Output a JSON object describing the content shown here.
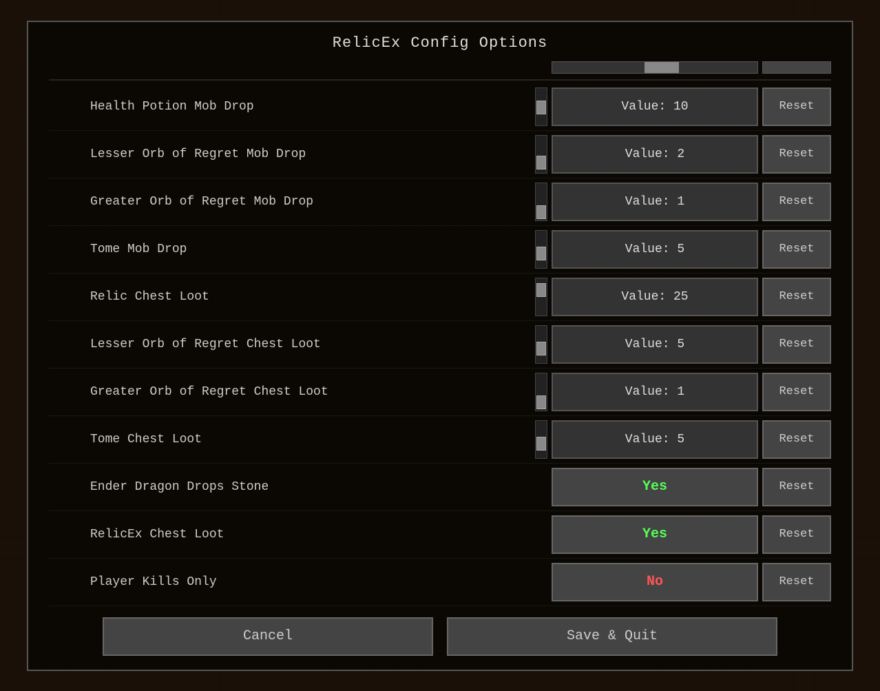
{
  "title": "RelicEx Config Options",
  "rows": [
    {
      "id": "health-potion-mob-drop",
      "label": "Health Potion Mob Drop",
      "type": "slider",
      "value": "Value: 10",
      "sliderPos": 0.5
    },
    {
      "id": "lesser-orb-mob-drop",
      "label": "Lesser Orb of Regret Mob Drop",
      "type": "slider",
      "value": "Value: 2",
      "sliderPos": 0.2
    },
    {
      "id": "greater-orb-mob-drop",
      "label": "Greater Orb of Regret Mob Drop",
      "type": "slider",
      "value": "Value: 1",
      "sliderPos": 0.1
    },
    {
      "id": "tome-mob-drop",
      "label": "Tome Mob Drop",
      "type": "slider",
      "value": "Value: 5",
      "sliderPos": 0.35
    },
    {
      "id": "relic-chest-loot",
      "label": "Relic Chest Loot",
      "type": "slider",
      "value": "Value: 25",
      "sliderPos": 0.8
    },
    {
      "id": "lesser-orb-chest-loot",
      "label": "Lesser Orb of Regret Chest Loot",
      "type": "slider",
      "value": "Value: 5",
      "sliderPos": 0.35
    },
    {
      "id": "greater-orb-chest-loot",
      "label": "Greater Orb of Regret Chest Loot",
      "type": "slider",
      "value": "Value: 1",
      "sliderPos": 0.1
    },
    {
      "id": "tome-chest-loot",
      "label": "Tome Chest Loot",
      "type": "slider",
      "value": "Value: 5",
      "sliderPos": 0.35
    },
    {
      "id": "ender-dragon-drops-stone",
      "label": "Ender Dragon Drops Stone",
      "type": "toggle",
      "value": "Yes",
      "toggleState": "yes"
    },
    {
      "id": "relicex-chest-loot",
      "label": "RelicEx Chest Loot",
      "type": "toggle",
      "value": "Yes",
      "toggleState": "yes"
    },
    {
      "id": "player-kills-only",
      "label": "Player Kills Only",
      "type": "toggle",
      "value": "No",
      "toggleState": "no"
    }
  ],
  "buttons": {
    "cancel": "Cancel",
    "save_quit": "Save & Quit",
    "reset": "Reset"
  }
}
